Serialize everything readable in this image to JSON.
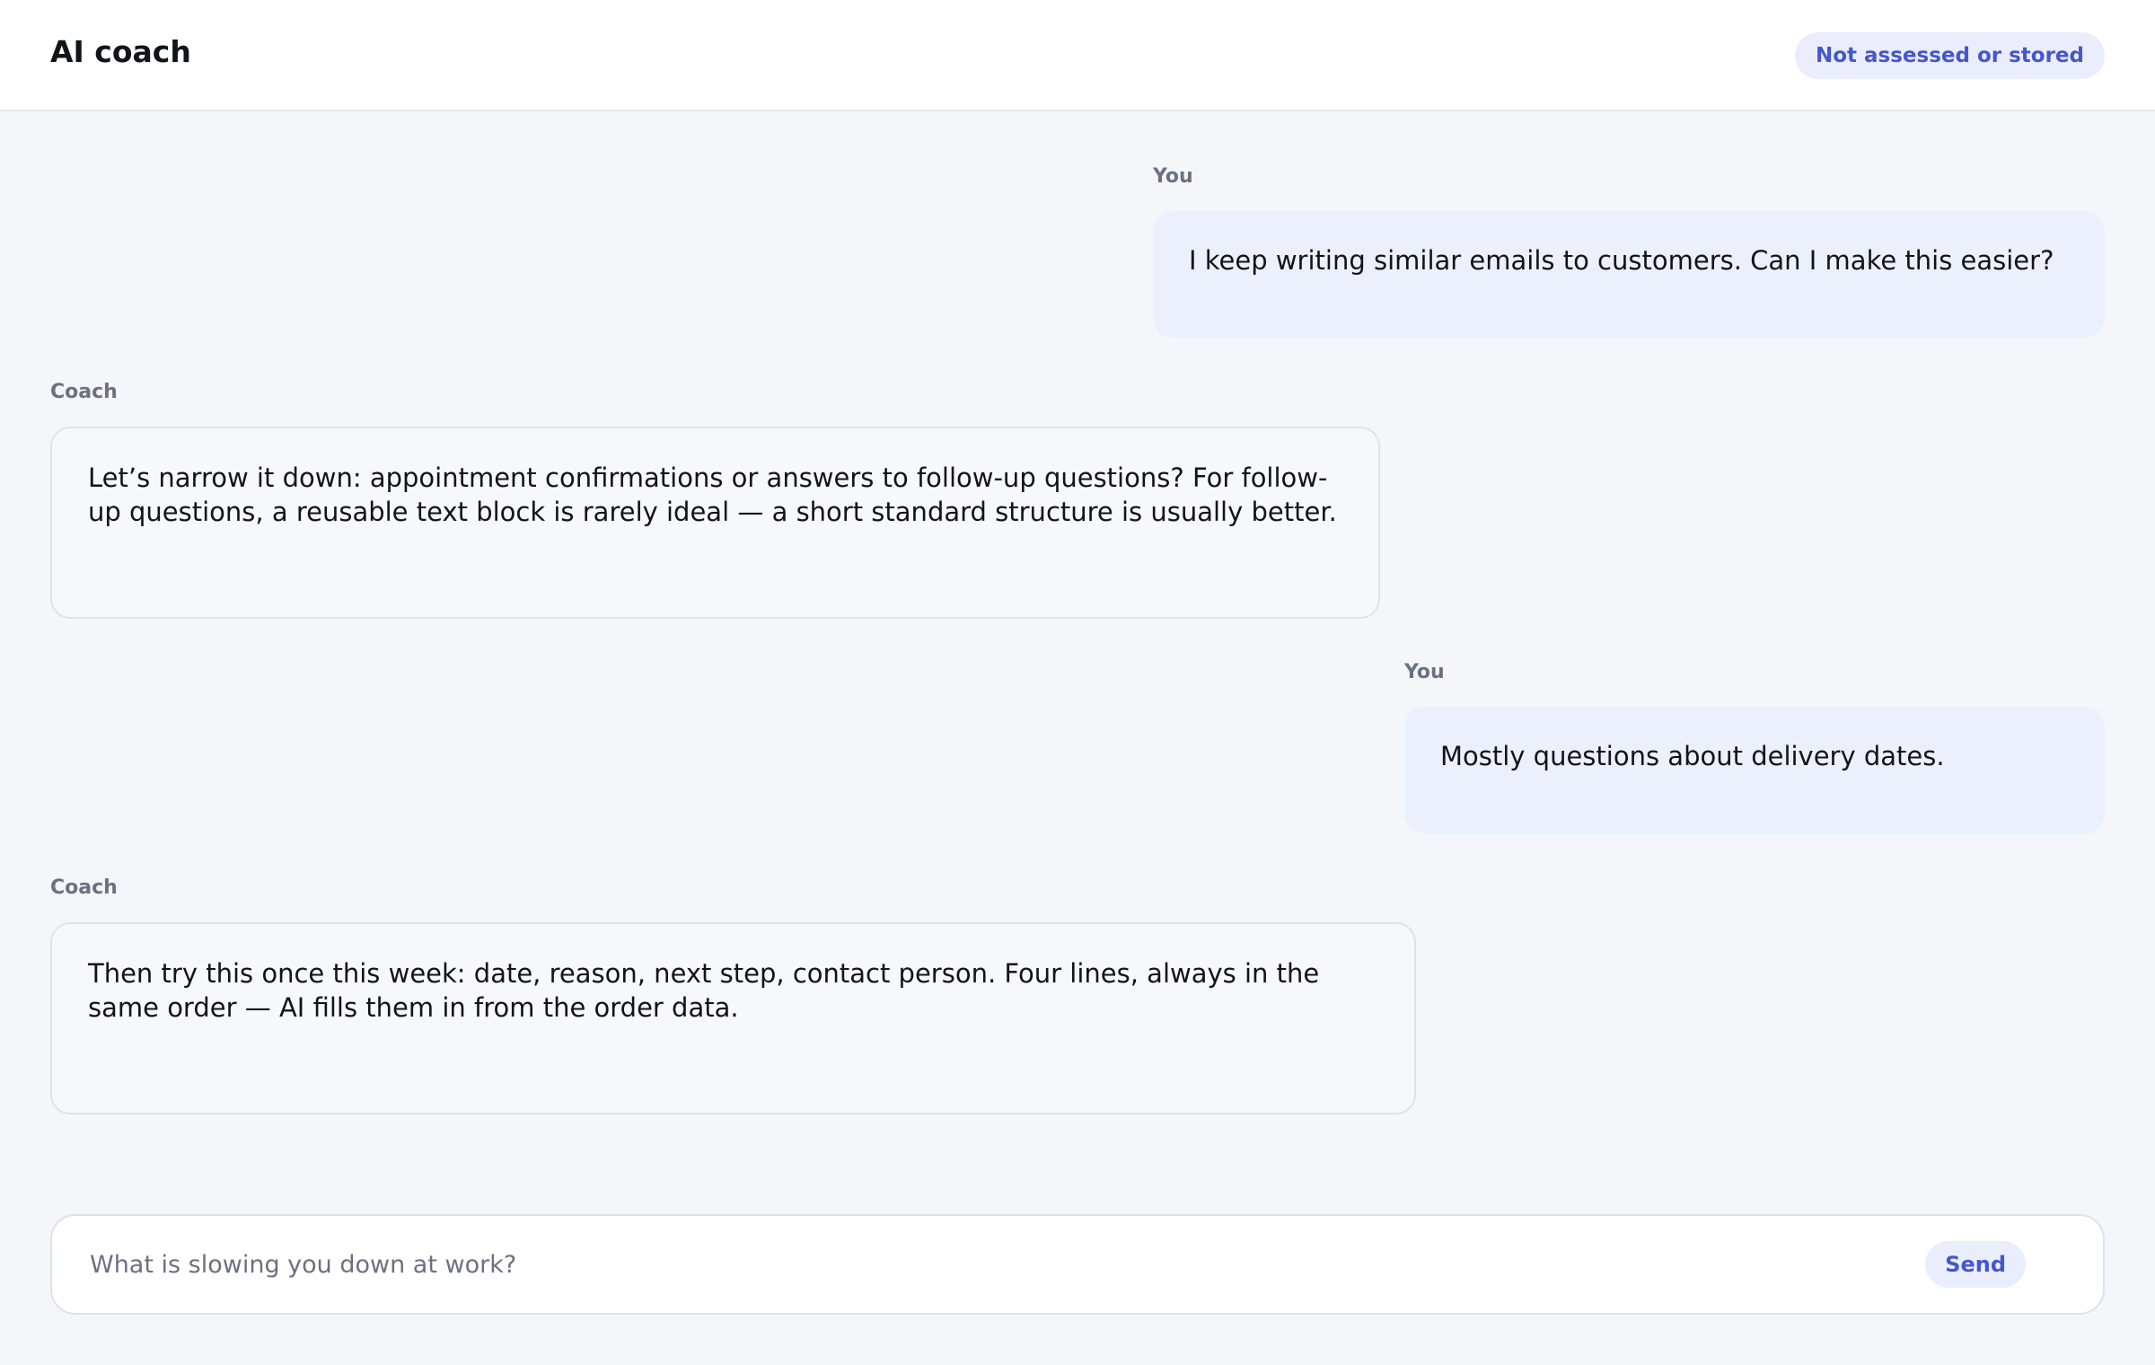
{
  "header": {
    "title": "AI coach",
    "badge": "Not assessed or stored"
  },
  "messages": [
    {
      "speaker": "You",
      "role": "user",
      "text": "I keep writing similar emails to customers. Can I make this easier?"
    },
    {
      "speaker": "Coach",
      "role": "coach",
      "text": "Let’s narrow it down: appointment confirmations or answers to follow-up questions? For follow-up questions, a reusable text block is rarely ideal — a short standard structure is usually better."
    },
    {
      "speaker": "You",
      "role": "user",
      "text": "Mostly questions about delivery dates."
    },
    {
      "speaker": "Coach",
      "role": "coach",
      "text": "Then try this once this week: date, reason, next step, contact person. Four lines, always in the same order — AI fills them in from the order data."
    }
  ],
  "composer": {
    "placeholder": "What is slowing you down at work?",
    "value": "",
    "send_label": "Send"
  },
  "colors": {
    "accent": "#4457cf",
    "user_bubble": "#ecf0fd",
    "coach_bubble": "#f7f8fb",
    "page_background": "#f5f6fa"
  }
}
